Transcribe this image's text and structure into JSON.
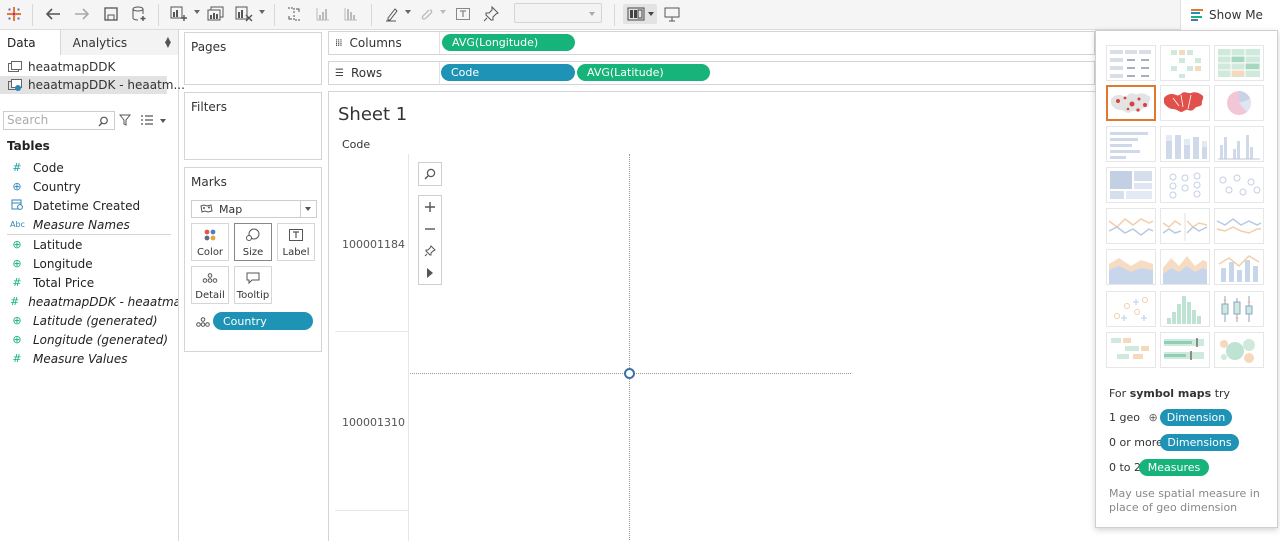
{
  "toolbar": {
    "fit_value": "",
    "show_me_label": "Show Me"
  },
  "data_pane": {
    "tabs": {
      "data": "Data",
      "analytics": "Analytics"
    },
    "datasources": [
      "heaatmapDDK",
      "heaatmapDDK - heaatm..."
    ],
    "search_placeholder": "Search",
    "tables_header": "Tables",
    "fields": [
      {
        "icon": "#",
        "label": "Code",
        "italic": false,
        "color": "#1b9e9e"
      },
      {
        "icon": "globe",
        "label": "Country",
        "italic": false,
        "color": "#2e86b8"
      },
      {
        "icon": "calendar",
        "label": "Datetime Created",
        "italic": false,
        "color": "#2e86b8"
      },
      {
        "icon": "Abc",
        "label": "Measure Names",
        "italic": true,
        "color": "#2e86b8"
      },
      {
        "icon": "globe",
        "label": "Latitude",
        "italic": false,
        "color": "#16b37a"
      },
      {
        "icon": "globe",
        "label": "Longitude",
        "italic": false,
        "color": "#16b37a"
      },
      {
        "icon": "#",
        "label": "Total Price",
        "italic": false,
        "color": "#16b37a"
      },
      {
        "icon": "#",
        "label": "heaatmapDDK - heaatma...",
        "italic": true,
        "color": "#16b37a"
      },
      {
        "icon": "globe",
        "label": "Latitude (generated)",
        "italic": true,
        "color": "#16b37a"
      },
      {
        "icon": "globe",
        "label": "Longitude (generated)",
        "italic": true,
        "color": "#16b37a"
      },
      {
        "icon": "#",
        "label": "Measure Values",
        "italic": true,
        "color": "#16b37a"
      }
    ]
  },
  "shelves": {
    "pages": "Pages",
    "filters": "Filters",
    "marks": "Marks",
    "mark_type": "Map",
    "mark_buttons": {
      "color": "Color",
      "size": "Size",
      "label": "Label",
      "detail": "Detail",
      "tooltip": "Tooltip"
    },
    "detail_pill": "Country",
    "columns_label": "Columns",
    "rows_label": "Rows",
    "columns_pills": [
      "AVG(Longitude)"
    ],
    "rows_pills": [
      "Code",
      "AVG(Latitude)"
    ]
  },
  "sheet": {
    "title": "Sheet 1",
    "row_header": "Code",
    "rows": [
      "100001184",
      "100001310"
    ]
  },
  "show_me": {
    "for_prefix": "For ",
    "for_chart": "symbol maps",
    "for_suffix": " try",
    "req1_prefix": "1 geo",
    "req1_pill": "Dimension",
    "req2_prefix": "0 or more",
    "req2_pill": "Dimensions",
    "req3_prefix": "0 to 2",
    "req3_pill": "Measures",
    "note": "May use spatial measure in place of geo dimension",
    "colors": {
      "dimension": "#1f93b5",
      "measure": "#16b37a",
      "selected": "#e0782f"
    }
  }
}
